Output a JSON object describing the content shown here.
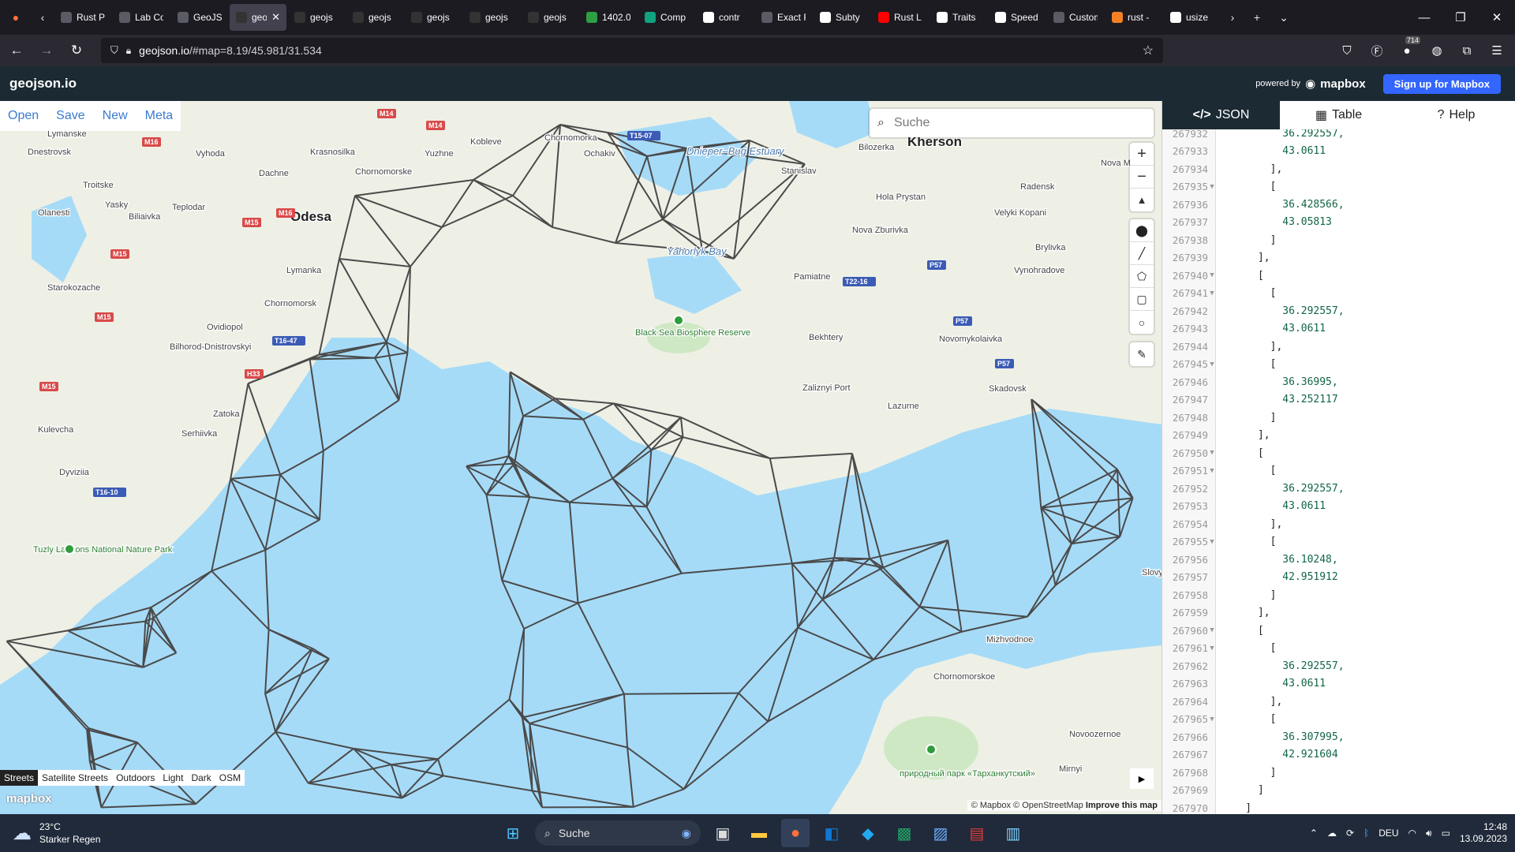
{
  "browser": {
    "tabs": [
      {
        "title": "Rust Playg",
        "icon": "rust-icon",
        "color": "#5b5b66"
      },
      {
        "title": "Lab Cours",
        "icon": "page-icon",
        "color": "#5b5b66"
      },
      {
        "title": "GeoJSON",
        "icon": "page-icon",
        "color": "#5b5b66"
      },
      {
        "title": "geo",
        "icon": "geojson-icon",
        "color": "#333",
        "active": true
      },
      {
        "title": "geojs",
        "icon": "geojson-icon",
        "color": "#333"
      },
      {
        "title": "geojs",
        "icon": "geojson-icon",
        "color": "#333"
      },
      {
        "title": "geojs",
        "icon": "geojson-icon",
        "color": "#333"
      },
      {
        "title": "geojs",
        "icon": "geojson-icon",
        "color": "#333"
      },
      {
        "title": "geojs",
        "icon": "geojson-icon",
        "color": "#333"
      },
      {
        "title": "1402.0",
        "icon": "smiley-icon",
        "color": "#2ea043"
      },
      {
        "title": "Comp",
        "icon": "chat-icon",
        "color": "#10a37f"
      },
      {
        "title": "contr",
        "icon": "google-icon",
        "color": "#fff"
      },
      {
        "title": "Exact Rou",
        "icon": "page-icon",
        "color": "#5b5b66"
      },
      {
        "title": "Subty",
        "icon": "doc-icon",
        "color": "#fff"
      },
      {
        "title": "Rust L",
        "icon": "youtube-icon",
        "color": "#ff0000"
      },
      {
        "title": "Traits",
        "icon": "doc-icon",
        "color": "#fff"
      },
      {
        "title": "Speed",
        "icon": "github-icon",
        "color": "#fff"
      },
      {
        "title": "Customiza",
        "icon": "page-icon",
        "color": "#5b5b66"
      },
      {
        "title": "rust -",
        "icon": "so-icon",
        "color": "#f48024"
      },
      {
        "title": "usize",
        "icon": "rust-icon",
        "color": "#fff"
      }
    ],
    "url_host": "geojson.io",
    "url_path": "/#map=8.19/45.981/31.534",
    "badge_count": "714"
  },
  "app": {
    "logo": "geojson.io",
    "powered_by": "powered by",
    "mapbox": "mapbox",
    "signup": "Sign up for Mapbox",
    "menu": [
      "Open",
      "Save",
      "New",
      "Meta"
    ],
    "search_placeholder": "Suche",
    "map_styles": [
      "Streets",
      "Satellite Streets",
      "Outdoors",
      "Light",
      "Dark",
      "OSM"
    ],
    "selected_style": "Streets",
    "attribution": {
      "mapbox": "© Mapbox",
      "osm": "© OpenStreetMap",
      "improve": "Improve this map"
    },
    "panel_tabs": [
      "JSON",
      "Table",
      "Help"
    ],
    "active_panel_tab": "JSON"
  },
  "map_labels": [
    {
      "text": "Lymanske",
      "kind": "town"
    },
    {
      "text": "Dnestrovsk",
      "kind": "town"
    },
    {
      "text": "Vyhoda",
      "kind": "town"
    },
    {
      "text": "Krasnosilka",
      "kind": "town"
    },
    {
      "text": "Yuzhne",
      "kind": "town"
    },
    {
      "text": "Kobleve",
      "kind": "town"
    },
    {
      "text": "Chornomorka",
      "kind": "town"
    },
    {
      "text": "Ochakiv",
      "kind": "town"
    },
    {
      "text": "Dnieper–Bug Estuary",
      "kind": "water"
    },
    {
      "text": "Stanislav",
      "kind": "town"
    },
    {
      "text": "Bilozerka",
      "kind": "town"
    },
    {
      "text": "Kherson",
      "kind": "city"
    },
    {
      "text": "Nova M",
      "kind": "town"
    },
    {
      "text": "Troitske",
      "kind": "town"
    },
    {
      "text": "Dachne",
      "kind": "town"
    },
    {
      "text": "Chornomorske",
      "kind": "town"
    },
    {
      "text": "Yasky",
      "kind": "town"
    },
    {
      "text": "Olanesti",
      "kind": "town"
    },
    {
      "text": "Biliaivka",
      "kind": "town"
    },
    {
      "text": "Teplodar",
      "kind": "town"
    },
    {
      "text": "Odesa",
      "kind": "city"
    },
    {
      "text": "Radensk",
      "kind": "town"
    },
    {
      "text": "Hola Prystan",
      "kind": "town"
    },
    {
      "text": "Velyki Kopani",
      "kind": "town"
    },
    {
      "text": "Nova Zburivka",
      "kind": "town"
    },
    {
      "text": "Yahorlyk Bay",
      "kind": "water"
    },
    {
      "text": "Brylivka",
      "kind": "town"
    },
    {
      "text": "Lymanka",
      "kind": "town"
    },
    {
      "text": "Pamiatne",
      "kind": "town"
    },
    {
      "text": "Vynohradove",
      "kind": "town"
    },
    {
      "text": "Starokozache",
      "kind": "town"
    },
    {
      "text": "Chornomorsk",
      "kind": "town"
    },
    {
      "text": "Ovidiopol",
      "kind": "town"
    },
    {
      "text": "Black Sea Biosphere Reserve",
      "kind": "park"
    },
    {
      "text": "Bekhtery",
      "kind": "town"
    },
    {
      "text": "Novomykolaivka",
      "kind": "town"
    },
    {
      "text": "Bilhorod-Dnistrovskyi",
      "kind": "town"
    },
    {
      "text": "Zaliznyi Port",
      "kind": "town"
    },
    {
      "text": "Skadovsk",
      "kind": "town"
    },
    {
      "text": "Lazurne",
      "kind": "town"
    },
    {
      "text": "Zatoka",
      "kind": "town"
    },
    {
      "text": "Kulevcha",
      "kind": "town"
    },
    {
      "text": "Serhiivka",
      "kind": "town"
    },
    {
      "text": "Dyviziia",
      "kind": "town"
    },
    {
      "text": "Tuzly Lagoons National Nature Park",
      "kind": "park"
    },
    {
      "text": "Slovy",
      "kind": "town"
    },
    {
      "text": "Mizhvodnoe",
      "kind": "town"
    },
    {
      "text": "Chornomorskoe",
      "kind": "town"
    },
    {
      "text": "Novoozernoe",
      "kind": "town"
    },
    {
      "text": "Mirnyi",
      "kind": "town"
    },
    {
      "text": "природный парк «Тарханкутский»",
      "kind": "park"
    }
  ],
  "road_shields": [
    "M14",
    "M14",
    "M16",
    "M15",
    "M16",
    "M15",
    "M15",
    "M15",
    "T16-47",
    "H33",
    "T16-10",
    "T15-07",
    "T22-16",
    "P57",
    "P57",
    "P57"
  ],
  "json_lines": [
    {
      "n": "267932",
      "t": "          36.292557,",
      "fold": false
    },
    {
      "n": "267933",
      "t": "          43.0611",
      "fold": false
    },
    {
      "n": "267934",
      "t": "        ],",
      "fold": false
    },
    {
      "n": "267935",
      "t": "        [",
      "fold": true
    },
    {
      "n": "267936",
      "t": "          36.428566,",
      "fold": false
    },
    {
      "n": "267937",
      "t": "          43.05813",
      "fold": false
    },
    {
      "n": "267938",
      "t": "        ]",
      "fold": false
    },
    {
      "n": "267939",
      "t": "      ],",
      "fold": false
    },
    {
      "n": "267940",
      "t": "      [",
      "fold": true
    },
    {
      "n": "267941",
      "t": "        [",
      "fold": true
    },
    {
      "n": "267942",
      "t": "          36.292557,",
      "fold": false
    },
    {
      "n": "267943",
      "t": "          43.0611",
      "fold": false
    },
    {
      "n": "267944",
      "t": "        ],",
      "fold": false
    },
    {
      "n": "267945",
      "t": "        [",
      "fold": true
    },
    {
      "n": "267946",
      "t": "          36.36995,",
      "fold": false
    },
    {
      "n": "267947",
      "t": "          43.252117",
      "fold": false
    },
    {
      "n": "267948",
      "t": "        ]",
      "fold": false
    },
    {
      "n": "267949",
      "t": "      ],",
      "fold": false
    },
    {
      "n": "267950",
      "t": "      [",
      "fold": true
    },
    {
      "n": "267951",
      "t": "        [",
      "fold": true
    },
    {
      "n": "267952",
      "t": "          36.292557,",
      "fold": false
    },
    {
      "n": "267953",
      "t": "          43.0611",
      "fold": false
    },
    {
      "n": "267954",
      "t": "        ],",
      "fold": false
    },
    {
      "n": "267955",
      "t": "        [",
      "fold": true
    },
    {
      "n": "267956",
      "t": "          36.10248,",
      "fold": false
    },
    {
      "n": "267957",
      "t": "          42.951912",
      "fold": false
    },
    {
      "n": "267958",
      "t": "        ]",
      "fold": false
    },
    {
      "n": "267959",
      "t": "      ],",
      "fold": false
    },
    {
      "n": "267960",
      "t": "      [",
      "fold": true
    },
    {
      "n": "267961",
      "t": "        [",
      "fold": true
    },
    {
      "n": "267962",
      "t": "          36.292557,",
      "fold": false
    },
    {
      "n": "267963",
      "t": "          43.0611",
      "fold": false
    },
    {
      "n": "267964",
      "t": "        ],",
      "fold": false
    },
    {
      "n": "267965",
      "t": "        [",
      "fold": true
    },
    {
      "n": "267966",
      "t": "          36.307995,",
      "fold": false
    },
    {
      "n": "267967",
      "t": "          42.921604",
      "fold": false
    },
    {
      "n": "267968",
      "t": "        ]",
      "fold": false
    },
    {
      "n": "267969",
      "t": "      ]",
      "fold": false
    },
    {
      "n": "267970",
      "t": "    ]",
      "fold": false
    }
  ],
  "taskbar": {
    "temperature": "23°C",
    "weather": "Starker Regen",
    "search": "Suche",
    "language": "DEU",
    "time": "12:48",
    "date": "13.09.2023"
  },
  "colors": {
    "water": "#a6dbf8",
    "land": "#eef0e6",
    "mesh": "#4a4a4a",
    "accent": "#3366ff",
    "app_header": "#1b2a33"
  }
}
